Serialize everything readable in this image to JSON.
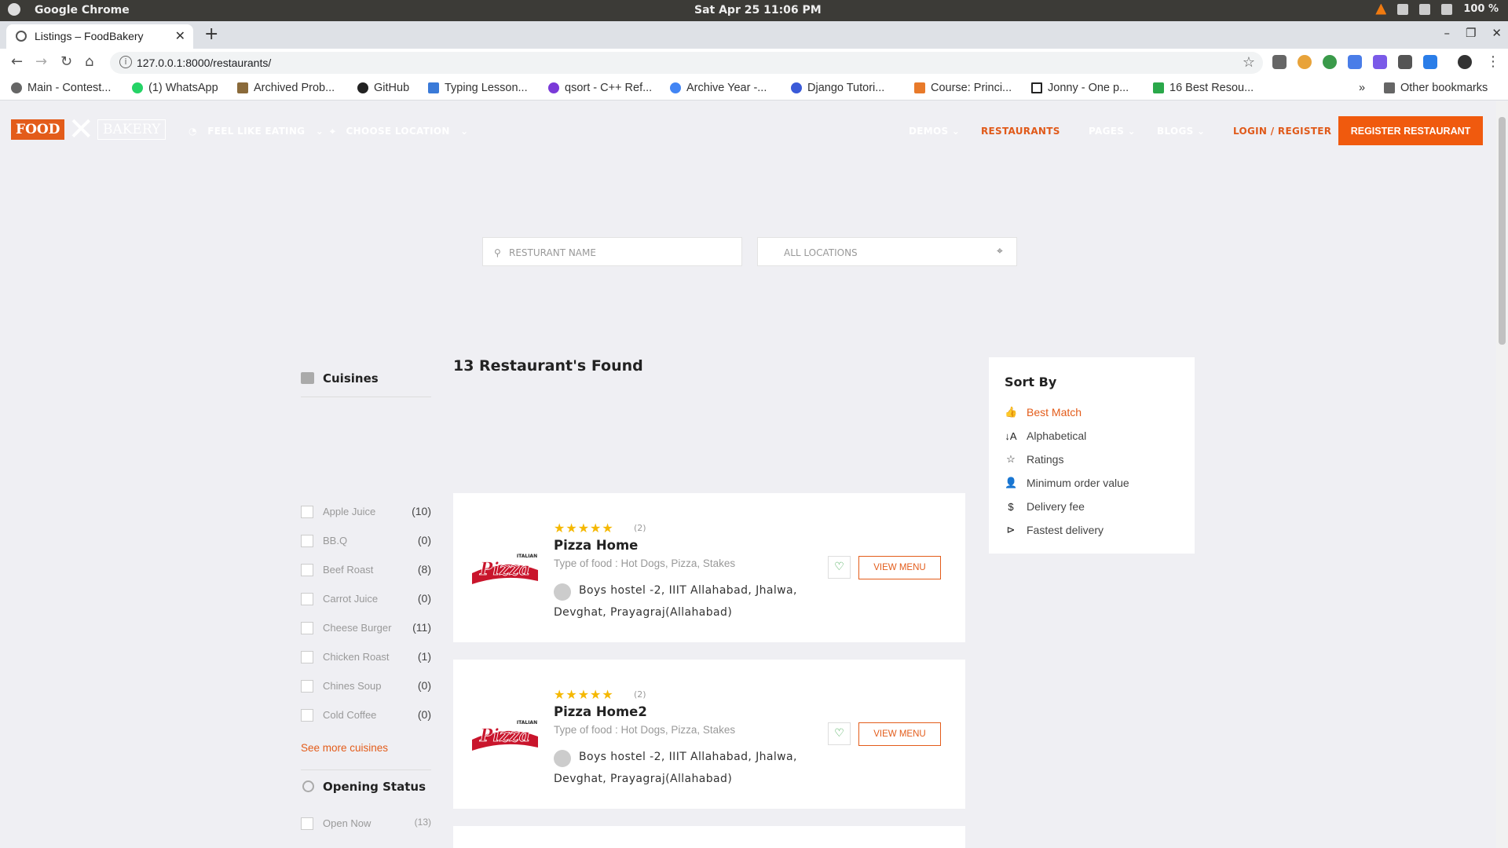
{
  "os": {
    "app_name": "Google Chrome",
    "clock": "Sat Apr 25  11:06 PM",
    "battery": "100 %"
  },
  "browser": {
    "tab_title": "Listings – FoodBakery",
    "url": "127.0.0.1:8000/restaurants/",
    "bookmarks": [
      "Main - Contest...",
      "(1) WhatsApp",
      "Archived Prob...",
      "GitHub",
      "Typing Lesson...",
      "qsort - C++ Ref...",
      "Archive Year -...",
      "Django Tutori...",
      "Course: Princi...",
      "Jonny - One p...",
      "16 Best Resou..."
    ],
    "other_bookmarks": "Other bookmarks"
  },
  "header": {
    "logo_food": "FOOD",
    "logo_bakery": "BAKERY",
    "feel_like_eating": "FEEL LIKE EATING",
    "choose_location": "CHOOSE LOCATION",
    "nav": [
      "DEMOS",
      "RESTAURANTS",
      "PAGES",
      "BLOGS"
    ],
    "login": "LOGIN / REGISTER",
    "register_btn": "REGISTER RESTAURANT"
  },
  "search": {
    "name_placeholder": "RESTURANT NAME",
    "location_placeholder": "ALL LOCATIONS"
  },
  "filters": {
    "cuisines_title": "Cuisines",
    "cuisines": [
      {
        "name": "Apple Juice",
        "count": "(10)"
      },
      {
        "name": "BB.Q",
        "count": "(0)"
      },
      {
        "name": "Beef Roast",
        "count": "(8)"
      },
      {
        "name": "Carrot Juice",
        "count": "(0)"
      },
      {
        "name": "Cheese Burger",
        "count": "(11)"
      },
      {
        "name": "Chicken Roast",
        "count": "(1)"
      },
      {
        "name": "Chines Soup",
        "count": "(0)"
      },
      {
        "name": "Cold Coffee",
        "count": "(0)"
      }
    ],
    "see_more": "See more cuisines",
    "opening_title": "Opening Status",
    "open_now": {
      "name": "Open Now",
      "count": "(13)"
    }
  },
  "results": {
    "found": "13 Restaurant's Found",
    "restaurants": [
      {
        "name": "Pizza Home",
        "rating_count": "(2)",
        "stars": 5,
        "type": "Type of food : Hot Dogs, Pizza, Stakes",
        "address": "Boys hostel -2, IIIT Allahabad, Jhalwa, Devghat, Prayagraj(Allahabad)",
        "view_menu": "VIEW MENU",
        "logo_text": "Pizza",
        "logo_sub": "ITALIAN"
      },
      {
        "name": "Pizza Home2",
        "rating_count": "(2)",
        "stars": 5,
        "type": "Type of food : Hot Dogs, Pizza, Stakes",
        "address": "Boys hostel -2, IIIT Allahabad, Jhalwa, Devghat, Prayagraj(Allahabad)",
        "view_menu": "VIEW MENU",
        "logo_text": "Pizza",
        "logo_sub": "ITALIAN"
      }
    ]
  },
  "sort": {
    "title": "Sort By",
    "options": [
      "Best Match",
      "Alphabetical",
      "Ratings",
      "Minimum order value",
      "Delivery fee",
      "Fastest delivery"
    ]
  },
  "colors": {
    "accent": "#e35c1a",
    "button": "#f05a0e",
    "star": "#f5b800"
  }
}
